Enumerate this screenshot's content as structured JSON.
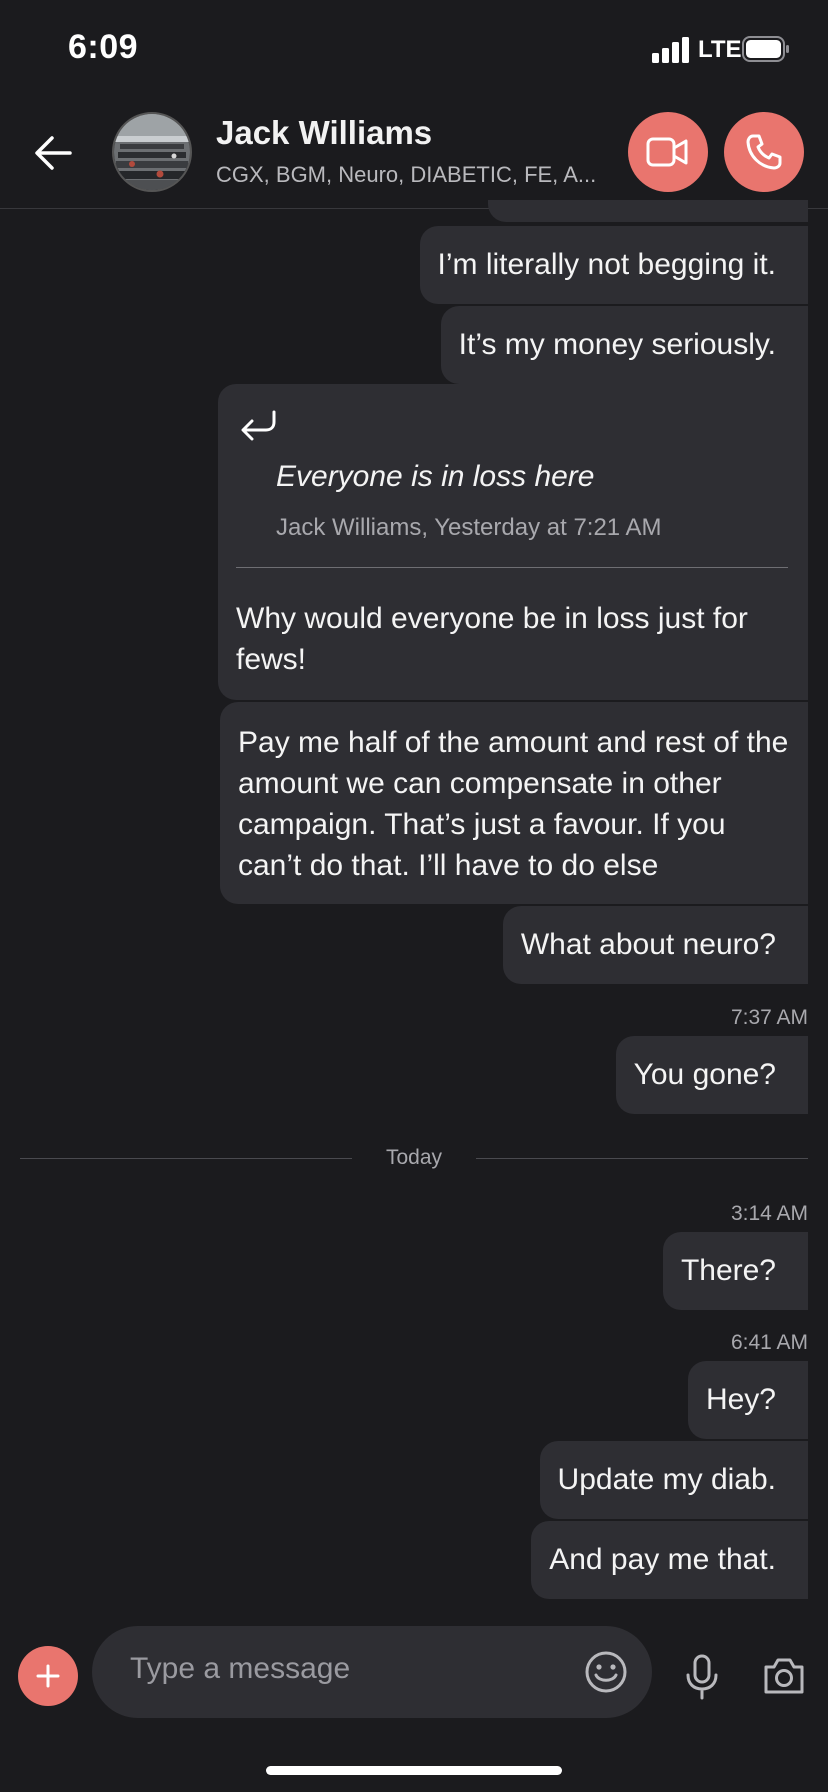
{
  "status_bar": {
    "time": "6:09",
    "network": "LTE"
  },
  "header": {
    "contact_name": "Jack Williams",
    "contact_subtitle": "CGX, BGM, Neuro, DIABETIC, FE, A..."
  },
  "messages": [
    {
      "text": "I’m literally not begging it."
    },
    {
      "text": "It’s my money seriously."
    },
    {
      "quote": {
        "text": "Everyone is in loss here",
        "meta": "Jack Williams, Yesterday at 7:21 AM"
      },
      "text": "Why would everyone be in loss just for fews!"
    },
    {
      "text": "Pay me half of the amount and rest of the amount we can compensate in other campaign. That’s just a favour. If you can’t do that. I’ll have to do else"
    },
    {
      "text": "What about neuro?"
    },
    {
      "timestamp": "7:37 AM",
      "text": "You gone?"
    },
    {
      "date_separator": "Today"
    },
    {
      "timestamp": "3:14 AM",
      "text": "There?"
    },
    {
      "timestamp": "6:41 AM",
      "text": "Hey?"
    },
    {
      "text": "Update my diab."
    },
    {
      "text": "And pay me that."
    }
  ],
  "composer": {
    "placeholder": "Type a message"
  },
  "colors": {
    "accent": "#e9756e",
    "background": "#1b1b1e",
    "bubble": "#2e2e33"
  },
  "icons": [
    "back-arrow-icon",
    "video-call-icon",
    "phone-call-icon",
    "reply-icon",
    "plus-icon",
    "emoji-icon",
    "microphone-icon",
    "camera-icon"
  ]
}
